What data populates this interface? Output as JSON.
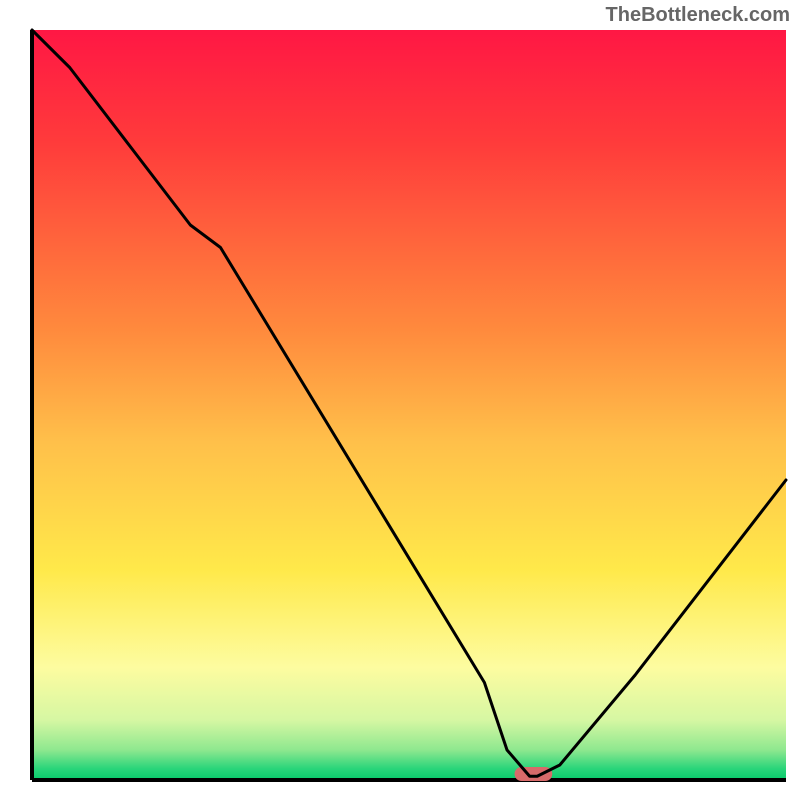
{
  "watermark": "TheBottleneck.com",
  "chart_data": {
    "type": "line",
    "title": "",
    "xlabel": "",
    "ylabel": "",
    "xlim": [
      0,
      100
    ],
    "ylim": [
      0,
      100
    ],
    "x": [
      0,
      5,
      21,
      25,
      60,
      63,
      66,
      67,
      70,
      80,
      100
    ],
    "y": [
      100,
      95,
      74,
      71,
      13,
      4,
      0.5,
      0.5,
      2,
      14,
      40
    ],
    "marker": {
      "x_left": 64,
      "x_right": 69,
      "y": 0.8,
      "color": "#d86a6a"
    },
    "gradient_stops": [
      {
        "offset": 0,
        "color": "#ff1744"
      },
      {
        "offset": 15,
        "color": "#ff3b3b"
      },
      {
        "offset": 40,
        "color": "#ff8a3d"
      },
      {
        "offset": 55,
        "color": "#ffc04a"
      },
      {
        "offset": 72,
        "color": "#ffe94a"
      },
      {
        "offset": 85,
        "color": "#fdfca0"
      },
      {
        "offset": 92,
        "color": "#d6f7a3"
      },
      {
        "offset": 96,
        "color": "#8ee88f"
      },
      {
        "offset": 98.5,
        "color": "#29d57a"
      },
      {
        "offset": 100,
        "color": "#08c96b"
      }
    ],
    "axis_color": "#000000",
    "curve_color": "#000000"
  }
}
